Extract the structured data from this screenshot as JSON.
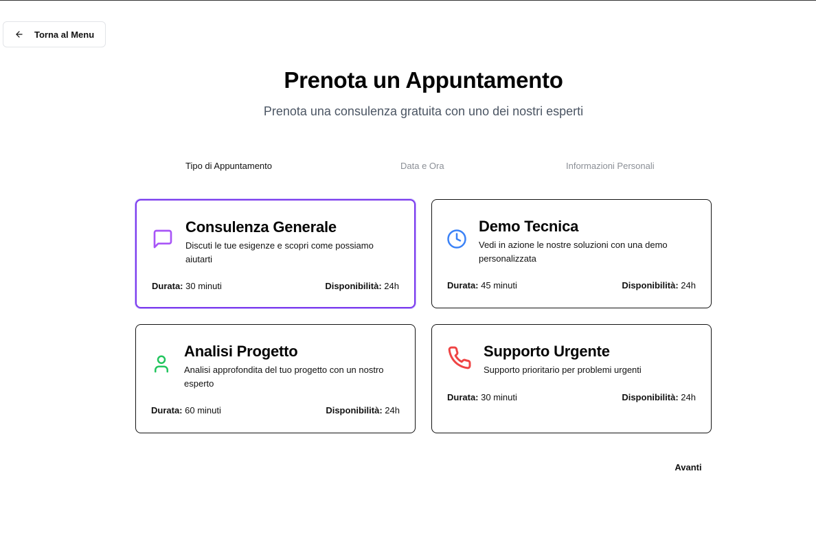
{
  "back_button": {
    "label": "Torna al Menu",
    "icon": "arrow-left-icon"
  },
  "header": {
    "title": "Prenota un Appuntamento",
    "subtitle": "Prenota una consulenza gratuita con uno dei nostri esperti"
  },
  "steps": [
    {
      "label": "Tipo di Appuntamento",
      "state": "active"
    },
    {
      "label": "Data e Ora",
      "state": "inactive"
    },
    {
      "label": "Informazioni Personali",
      "state": "inactive"
    }
  ],
  "duration_label": "Durata:",
  "availability_label": "Disponibilità:",
  "cards": [
    {
      "title": "Consulenza Generale",
      "description": "Discuti le tue esigenze e scopri come possiamo aiutarti",
      "duration": "30 minuti",
      "availability": "24h",
      "icon": "message-square-icon",
      "icon_color": "#a855f7",
      "selected": true
    },
    {
      "title": "Demo Tecnica",
      "description": "Vedi in azione le nostre soluzioni con una demo personalizzata",
      "duration": "45 minuti",
      "availability": "24h",
      "icon": "clock-icon",
      "icon_color": "#3b82f6",
      "selected": false
    },
    {
      "title": "Analisi Progetto",
      "description": "Analisi approfondita del tuo progetto con un nostro esperto",
      "duration": "60 minuti",
      "availability": "24h",
      "icon": "user-icon",
      "icon_color": "#22c55e",
      "selected": false
    },
    {
      "title": "Supporto Urgente",
      "description": "Supporto prioritario per problemi urgenti",
      "duration": "30 minuti",
      "availability": "24h",
      "icon": "phone-icon",
      "icon_color": "#ef4444",
      "selected": false
    }
  ],
  "next_button": {
    "label": "Avanti"
  },
  "colors": {
    "selected_border": "#7c3aed",
    "subtitle": "#4b5563",
    "inactive_step": "#8b8f96"
  }
}
